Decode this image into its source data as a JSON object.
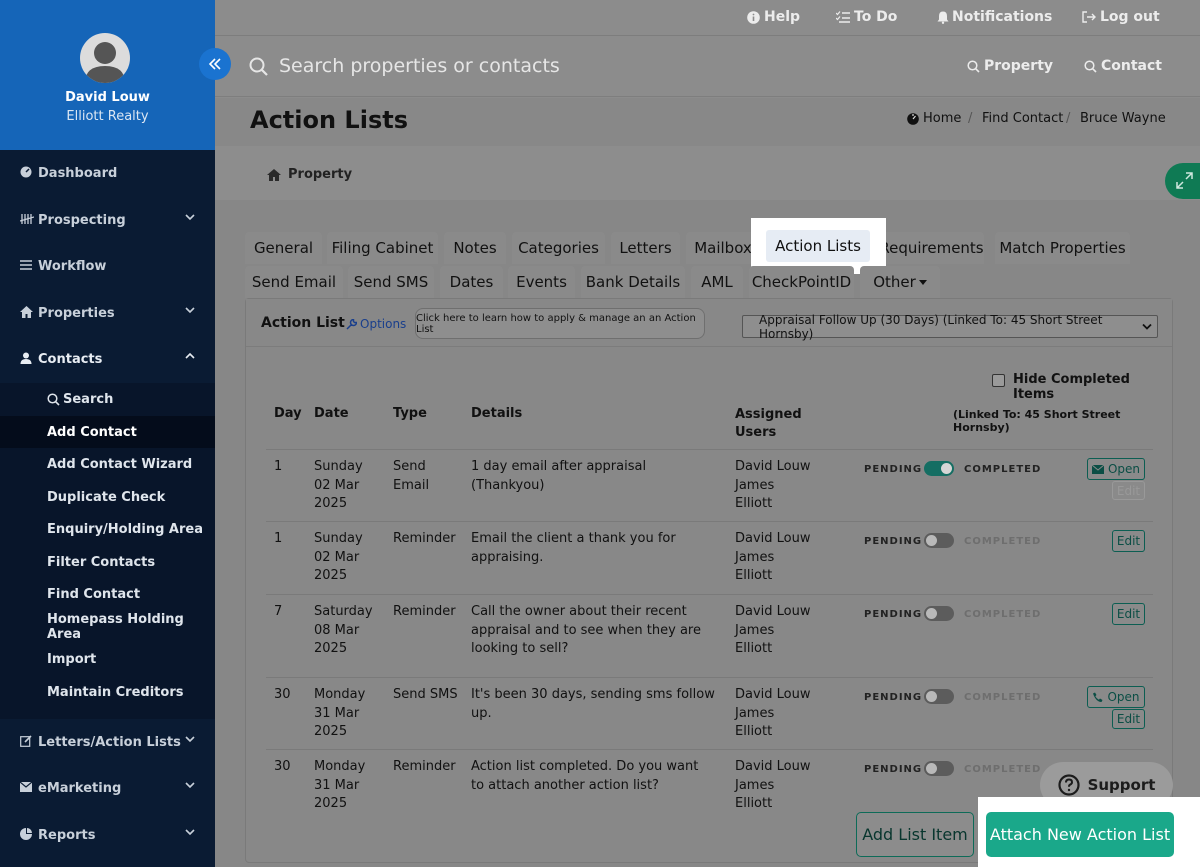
{
  "user": {
    "name": "David Louw",
    "company": "Elliott Realty"
  },
  "sidebar": {
    "items": [
      {
        "label": "Dashboard"
      },
      {
        "label": "Prospecting"
      },
      {
        "label": "Workflow"
      },
      {
        "label": "Properties"
      },
      {
        "label": "Contacts"
      },
      {
        "label": "Letters/Action Lists"
      },
      {
        "label": "eMarketing"
      },
      {
        "label": "Reports"
      }
    ],
    "contacts_sub": [
      {
        "label": "Search"
      },
      {
        "label": "Add Contact"
      },
      {
        "label": "Add Contact Wizard"
      },
      {
        "label": "Duplicate Check"
      },
      {
        "label": "Enquiry/Holding Area"
      },
      {
        "label": "Filter Contacts"
      },
      {
        "label": "Find Contact"
      },
      {
        "label": "Homepass Holding Area"
      },
      {
        "label": "Import"
      },
      {
        "label": "Maintain Creditors"
      }
    ]
  },
  "topbar": {
    "help": "Help",
    "todo": "To Do",
    "notifications": "Notifications",
    "logout": "Log out"
  },
  "search": {
    "placeholder": "Search properties or contacts",
    "property": "Property",
    "contact": "Contact"
  },
  "page": {
    "title": "Action Lists",
    "breadcrumb": [
      "Home",
      "Find Contact",
      "Bruce Wayne"
    ],
    "sub_link": "Property"
  },
  "tabs": {
    "row1": [
      "General",
      "Filing Cabinet",
      "Notes",
      "Categories",
      "Letters",
      "Mailbox",
      "Action Lists",
      "Requirements",
      "Match Properties"
    ],
    "row2": [
      "Send Email",
      "Send SMS",
      "Dates",
      "Events",
      "Bank Details",
      "AML",
      "CheckPointID",
      "Other"
    ]
  },
  "panel": {
    "title": "Action List",
    "options": "Options",
    "learn": "Click here to learn how to apply & manage an an Action List",
    "selected_list": "Appraisal Follow Up (30 Days) (Linked To: 45 Short Street Hornsby)",
    "hide_completed": "Hide Completed Items",
    "linked_to": "(Linked To: 45 Short Street Hornsby)"
  },
  "table": {
    "headers": {
      "day": "Day",
      "date": "Date",
      "type": "Type",
      "details": "Details",
      "assigned": "Assigned Users"
    },
    "pending_label": "PENDING",
    "completed_label": "COMPLETED",
    "open_label": "Open",
    "edit_label": "Edit",
    "rows": [
      {
        "day": "1",
        "date": "Sunday 02 Mar 2025",
        "type": "Send Email",
        "details": "1 day email after appraisal (Thankyou)",
        "users": "David Louw James Elliott",
        "completed": true
      },
      {
        "day": "1",
        "date": "Sunday 02 Mar 2025",
        "type": "Reminder",
        "details": "Email the client a thank you for appraising.",
        "users": "David Louw James Elliott",
        "completed": false
      },
      {
        "day": "7",
        "date": "Saturday 08 Mar 2025",
        "type": "Reminder",
        "details": "Call the owner about their recent appraisal and to see when they are looking to sell?",
        "users": "David Louw James Elliott",
        "completed": false
      },
      {
        "day": "30",
        "date": "Monday 31 Mar 2025",
        "type": "Send SMS",
        "details": "It's been 30 days, sending sms follow up.",
        "users": "David Louw James Elliott",
        "completed": false
      },
      {
        "day": "30",
        "date": "Monday 31 Mar 2025",
        "type": "Reminder",
        "details": "Action list completed. Do you want to attach another action list?",
        "users": "David Louw James Elliott",
        "completed": false
      }
    ]
  },
  "buttons": {
    "add_item": "Add List Item",
    "attach": "Attach New Action List",
    "support": "Support"
  },
  "colors": {
    "sidebar_bg": "#0a1b33",
    "profile_bg": "#1565b8",
    "accent_green": "#1aa88a",
    "collapse_blue": "#1a73d0"
  }
}
